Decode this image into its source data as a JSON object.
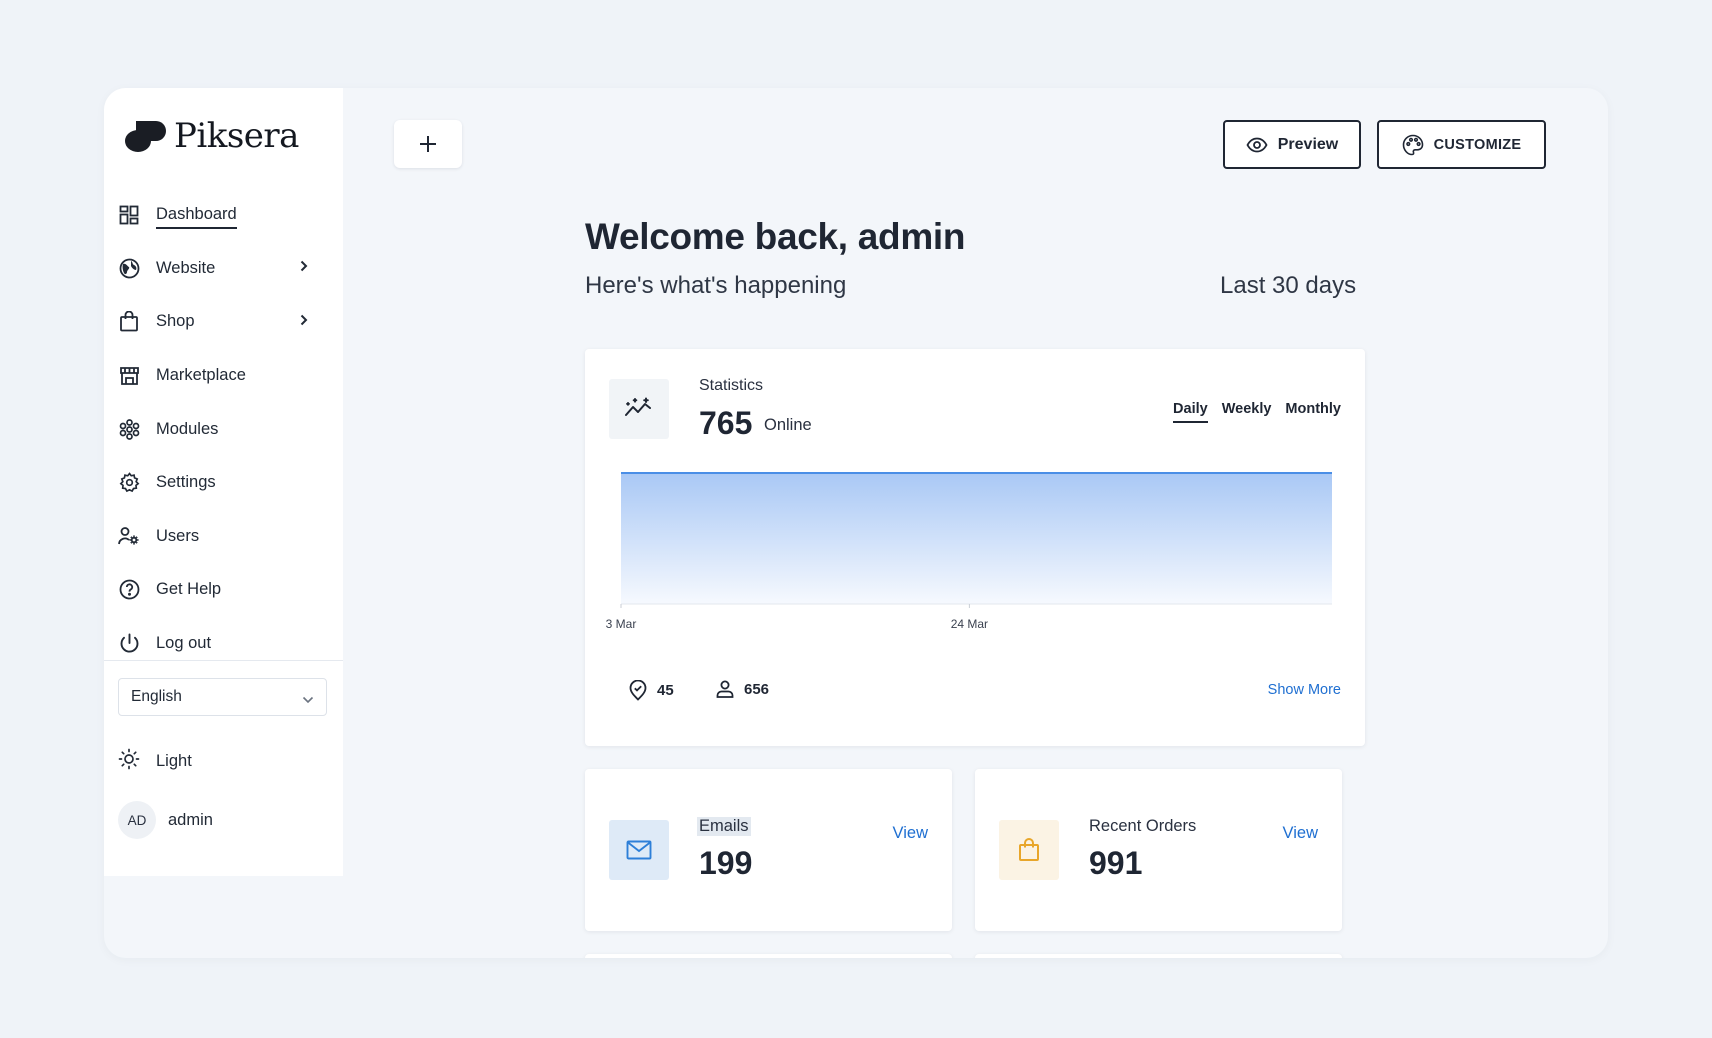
{
  "brand": {
    "name": "Piksera"
  },
  "sidebar": {
    "items": [
      {
        "label": "Dashboard",
        "icon": "dashboard-icon"
      },
      {
        "label": "Website",
        "icon": "globe-icon"
      },
      {
        "label": "Shop",
        "icon": "shopping-bag-icon"
      },
      {
        "label": "Marketplace",
        "icon": "storefront-icon"
      },
      {
        "label": "Modules",
        "icon": "modules-icon"
      },
      {
        "label": "Settings",
        "icon": "gear-icon"
      },
      {
        "label": "Users",
        "icon": "users-cog-icon"
      },
      {
        "label": "Get Help",
        "icon": "help-circle-icon"
      },
      {
        "label": "Log out",
        "icon": "power-icon"
      }
    ],
    "language": "English",
    "theme_label": "Light",
    "user": {
      "initials": "AD",
      "name": "admin"
    }
  },
  "toolbar": {
    "add_label": "+",
    "preview_label": "Preview",
    "customize_label": "CUSTOMIZE"
  },
  "header": {
    "title": "Welcome back, admin",
    "subtitle": "Here's what's happening",
    "period": "Last 30 days"
  },
  "stats": {
    "label": "Statistics",
    "value": "765",
    "unit": "Online",
    "tabs": [
      "Daily",
      "Weekly",
      "Monthly"
    ],
    "active_tab": "Daily",
    "metrics": [
      {
        "icon": "location-pin-icon",
        "value": "45"
      },
      {
        "icon": "user-icon",
        "value": "656"
      }
    ],
    "show_more": "Show More"
  },
  "chart_data": {
    "type": "area",
    "x": [
      "3 Mar",
      "24 Mar"
    ],
    "x_ticks": [
      "3 Mar",
      "24 Mar"
    ],
    "series": [
      {
        "values": [
          765,
          765
        ]
      }
    ],
    "grid": false,
    "colors": {
      "line": "#4a8ee6",
      "fill_top": "#a9c8f5",
      "fill_bottom": "#f6f9fe"
    }
  },
  "cards": [
    {
      "label": "Emails",
      "value": "199",
      "action": "View",
      "icon": "mail-icon",
      "tile_color": "#deeaf7",
      "icon_color": "#2d7fd8"
    },
    {
      "label": "Recent Orders",
      "value": "991",
      "action": "View",
      "icon": "shopping-bag-icon",
      "tile_color": "#fbf3e4",
      "icon_color": "#e8a62a"
    }
  ],
  "colors": {
    "accent": "#1f6fd1",
    "text": "#1f2633",
    "background": "#eff3f8"
  }
}
